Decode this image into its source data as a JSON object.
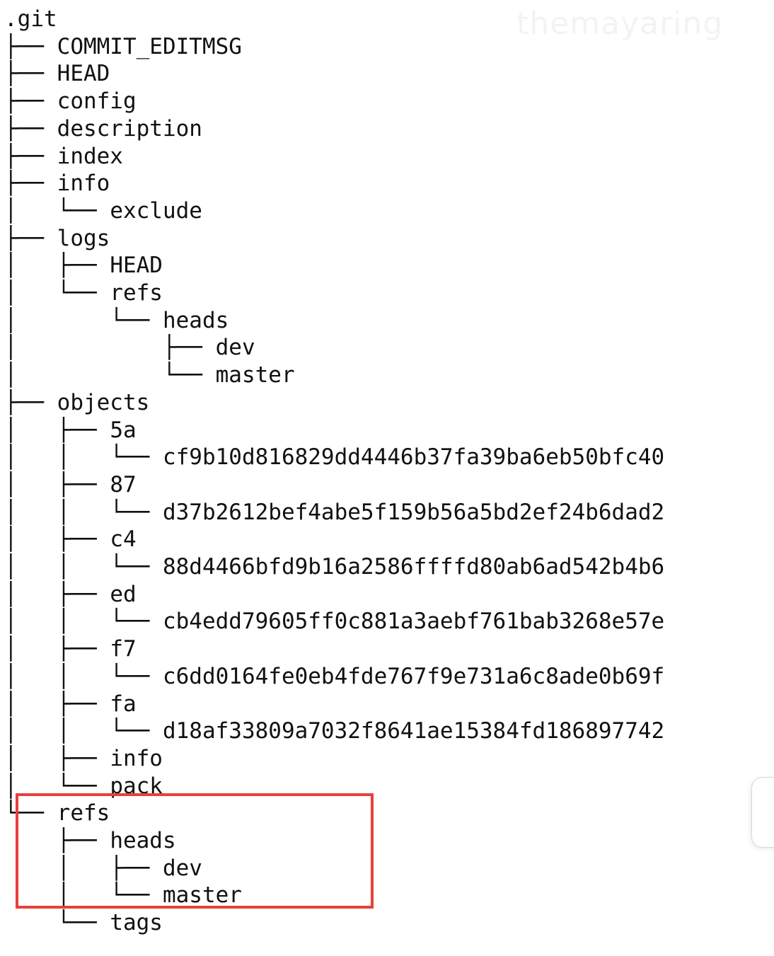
{
  "watermark": "themayaring",
  "highlight_color": "#e8403c",
  "tree": [
    {
      "prefix": "",
      "name": ".git"
    },
    {
      "prefix": "├── ",
      "name": "COMMIT_EDITMSG"
    },
    {
      "prefix": "├── ",
      "name": "HEAD"
    },
    {
      "prefix": "├── ",
      "name": "config"
    },
    {
      "prefix": "├── ",
      "name": "description"
    },
    {
      "prefix": "├── ",
      "name": "index"
    },
    {
      "prefix": "├── ",
      "name": "info"
    },
    {
      "prefix": "│   └── ",
      "name": "exclude"
    },
    {
      "prefix": "├── ",
      "name": "logs"
    },
    {
      "prefix": "│   ├── ",
      "name": "HEAD"
    },
    {
      "prefix": "│   └── ",
      "name": "refs"
    },
    {
      "prefix": "│       └── ",
      "name": "heads"
    },
    {
      "prefix": "│           ├── ",
      "name": "dev"
    },
    {
      "prefix": "│           └── ",
      "name": "master"
    },
    {
      "prefix": "├── ",
      "name": "objects"
    },
    {
      "prefix": "│   ├── ",
      "name": "5a"
    },
    {
      "prefix": "│   │   └── ",
      "name": "cf9b10d816829dd4446b37fa39ba6eb50bfc40"
    },
    {
      "prefix": "│   ├── ",
      "name": "87"
    },
    {
      "prefix": "│   │   └── ",
      "name": "d37b2612bef4abe5f159b56a5bd2ef24b6dad2"
    },
    {
      "prefix": "│   ├── ",
      "name": "c4"
    },
    {
      "prefix": "│   │   └── ",
      "name": "88d4466bfd9b16a2586ffffd80ab6ad542b4b6"
    },
    {
      "prefix": "│   ├── ",
      "name": "ed"
    },
    {
      "prefix": "│   │   └── ",
      "name": "cb4edd79605ff0c881a3aebf761bab3268e57e"
    },
    {
      "prefix": "│   ├── ",
      "name": "f7"
    },
    {
      "prefix": "│   │   └── ",
      "name": "c6dd0164fe0eb4fde767f9e731a6c8ade0b69f"
    },
    {
      "prefix": "│   ├── ",
      "name": "fa"
    },
    {
      "prefix": "│   │   └── ",
      "name": "d18af33809a7032f8641ae15384fd186897742"
    },
    {
      "prefix": "│   ├── ",
      "name": "info"
    },
    {
      "prefix": "│   └── ",
      "name": "pack"
    },
    {
      "prefix": "└── ",
      "name": "refs"
    },
    {
      "prefix": "    ├── ",
      "name": "heads"
    },
    {
      "prefix": "    │   ├── ",
      "name": "dev"
    },
    {
      "prefix": "    │   └── ",
      "name": "master"
    },
    {
      "prefix": "    └── ",
      "name": "tags"
    }
  ]
}
